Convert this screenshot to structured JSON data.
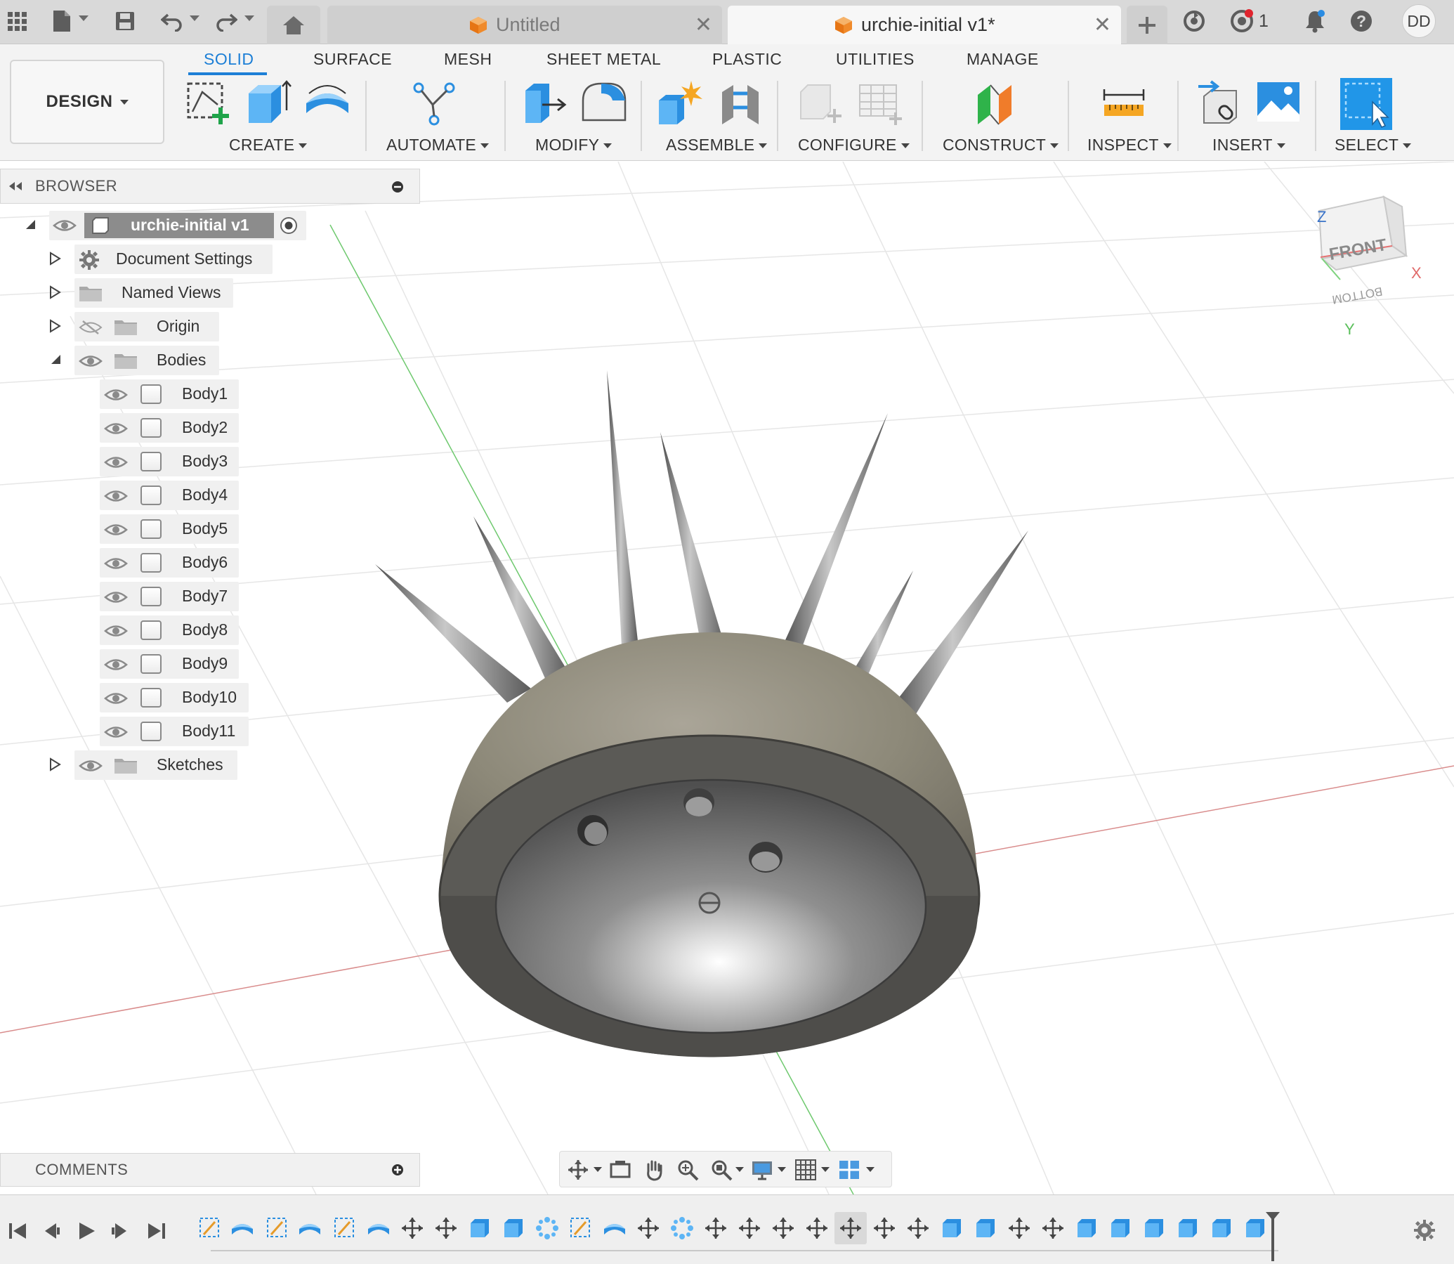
{
  "titlebar": {
    "tabs": [
      {
        "title": "Untitled",
        "active": false
      },
      {
        "title": "urchie-initial v1*",
        "active": true
      }
    ],
    "notification_count": "1",
    "user_initials": "DD",
    "icons": [
      "grid-icon",
      "file-icon",
      "save-icon",
      "undo-icon",
      "redo-icon",
      "home-icon",
      "new-tab-icon",
      "job-status-icon",
      "extensions-icon",
      "notifications-icon",
      "help-icon"
    ]
  },
  "ribbon": {
    "workspace": "DESIGN",
    "tabs": [
      "SOLID",
      "SURFACE",
      "MESH",
      "SHEET METAL",
      "PLASTIC",
      "UTILITIES",
      "MANAGE"
    ],
    "active_tab": "SOLID",
    "groups": [
      "CREATE",
      "AUTOMATE",
      "MODIFY",
      "ASSEMBLE",
      "CONFIGURE",
      "CONSTRUCT",
      "INSPECT",
      "INSERT",
      "SELECT"
    ]
  },
  "browser": {
    "title": "BROWSER",
    "root": "urchie-initial v1",
    "items": [
      "Document Settings",
      "Named Views",
      "Origin",
      "Bodies"
    ],
    "bodies": [
      "Body1",
      "Body2",
      "Body3",
      "Body4",
      "Body5",
      "Body6",
      "Body7",
      "Body8",
      "Body9",
      "Body10",
      "Body11"
    ],
    "last_item": "Sketches"
  },
  "viewcube": {
    "front": "FRONT",
    "bottom": "BOTTOM",
    "axis_x": "X",
    "axis_y": "Y",
    "axis_z": "Z"
  },
  "comments": {
    "title": "COMMENTS"
  },
  "colors": {
    "accent": "#1d7fd6",
    "ribbon_bg": "#f3f3f3",
    "titlebar_bg": "#d9d9d9",
    "model_shell": "#8e8a80",
    "model_rim": "#5b5a56",
    "axis_x": "#d98c8c",
    "axis_y": "#6fc96f"
  }
}
